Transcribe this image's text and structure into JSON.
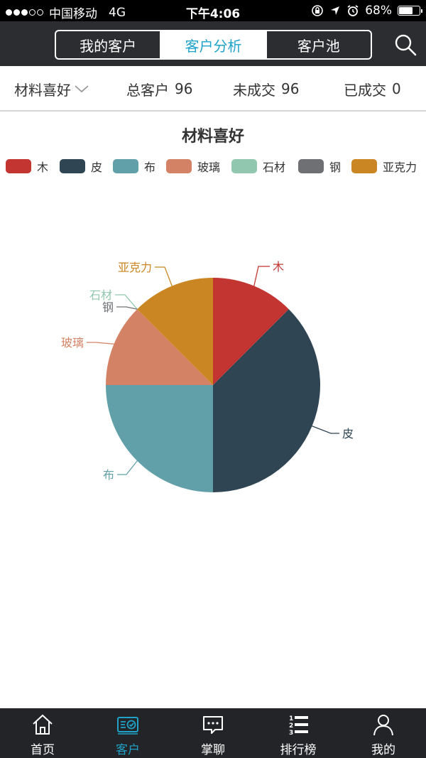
{
  "status_bar": {
    "carrier": "中国移动",
    "network": "4G",
    "time": "下午4:06",
    "battery": "68%",
    "battery_level": 0.68
  },
  "header": {
    "tabs": [
      {
        "label": "我的客户",
        "active": false
      },
      {
        "label": "客户分析",
        "active": true
      },
      {
        "label": "客户池",
        "active": false
      }
    ],
    "search_icon": "search-icon"
  },
  "summary": {
    "filter_label": "材料喜好",
    "total_label": "总客户",
    "total_value": "96",
    "pending_label": "未成交",
    "pending_value": "96",
    "closed_label": "已成交",
    "closed_value": "0"
  },
  "chart_data": {
    "type": "pie",
    "title": "材料喜好",
    "legend_position": "top",
    "slices": [
      {
        "label": "木",
        "value": 12,
        "color": "#c23531"
      },
      {
        "label": "皮",
        "value": 36,
        "color": "#2f4554"
      },
      {
        "label": "布",
        "value": 24,
        "color": "#61a0a8"
      },
      {
        "label": "玻璃",
        "value": 12,
        "color": "#d48265"
      },
      {
        "label": "石材",
        "value": 0,
        "color": "#91c7ae"
      },
      {
        "label": "钢",
        "value": 0,
        "color": "#6e7074"
      },
      {
        "label": "亚克力",
        "value": 12,
        "color": "#ca8622"
      }
    ]
  },
  "tab_bar": {
    "items": [
      {
        "label": "首页",
        "icon": "home-icon",
        "active": false
      },
      {
        "label": "客户",
        "icon": "customer-card-icon",
        "active": true
      },
      {
        "label": "掌聊",
        "icon": "chat-icon",
        "active": false
      },
      {
        "label": "排行榜",
        "icon": "ranking-list-icon",
        "active": false
      },
      {
        "label": "我的",
        "icon": "profile-icon",
        "active": false
      }
    ]
  }
}
